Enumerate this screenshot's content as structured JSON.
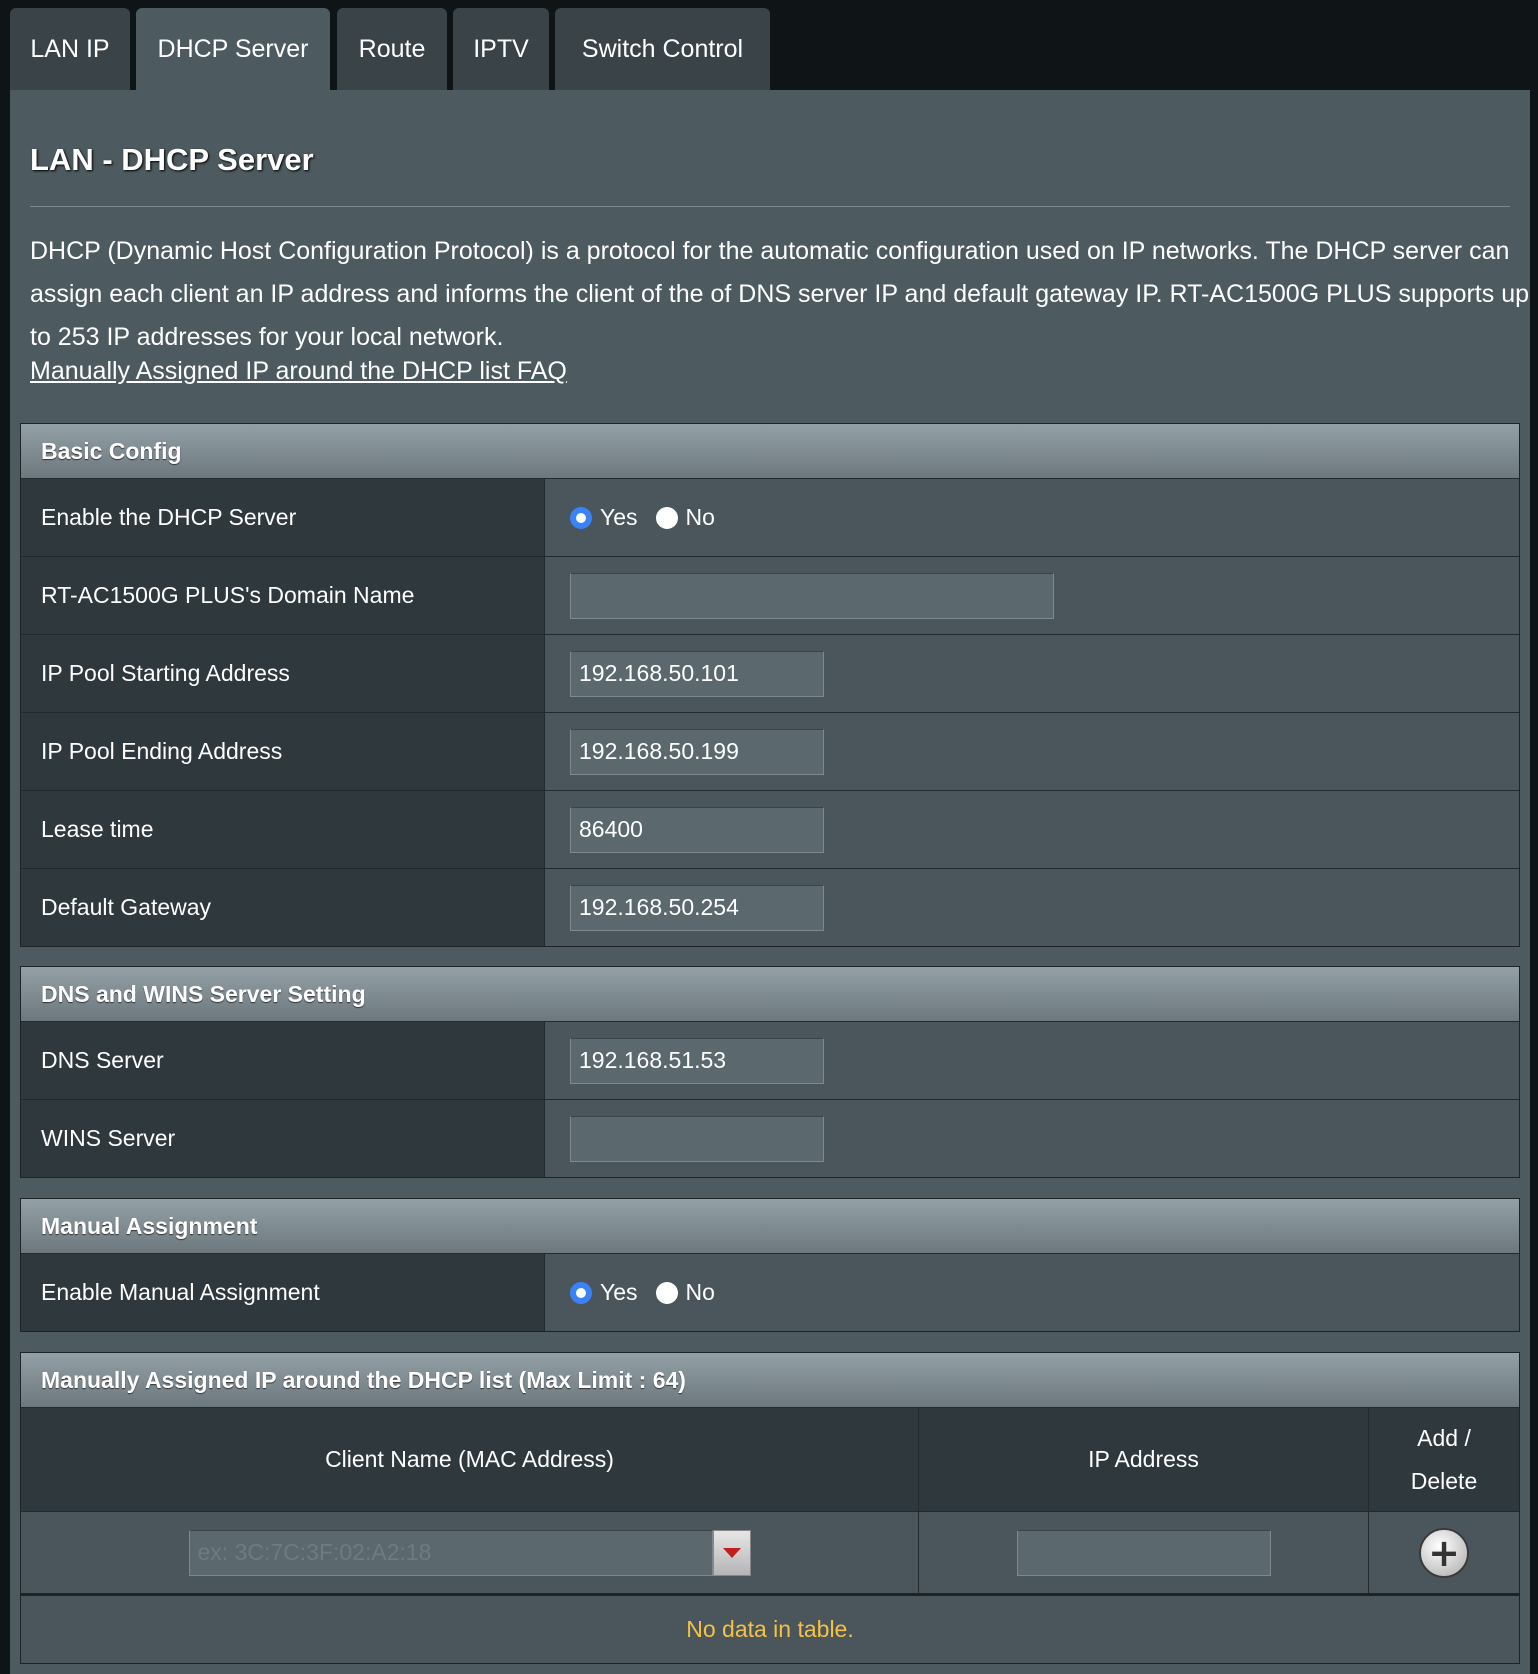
{
  "tabs": [
    {
      "label": "LAN IP"
    },
    {
      "label": "DHCP Server"
    },
    {
      "label": "Route"
    },
    {
      "label": "IPTV"
    },
    {
      "label": "Switch Control"
    }
  ],
  "page": {
    "title": "LAN - DHCP Server",
    "description": "DHCP (Dynamic Host Configuration Protocol) is a protocol for the automatic configuration used on IP networks. The DHCP server can assign each client an IP address and informs the client of the of DNS server IP and default gateway IP. RT-AC1500G PLUS supports up to 253 IP addresses for your local network.",
    "faq_link": "Manually Assigned IP around the DHCP list FAQ"
  },
  "basic": {
    "header": "Basic Config",
    "enable_label": "Enable the DHCP Server",
    "yes": "Yes",
    "no": "No",
    "domain_label": "RT-AC1500G PLUS's Domain Name",
    "domain_value": "",
    "start_label": "IP Pool Starting Address",
    "start_value": "192.168.50.101",
    "end_label": "IP Pool Ending Address",
    "end_value": "192.168.50.199",
    "lease_label": "Lease time",
    "lease_value": "86400",
    "gateway_label": "Default Gateway",
    "gateway_value": "192.168.50.254"
  },
  "dns": {
    "header": "DNS and WINS Server Setting",
    "dns_label": "DNS Server",
    "dns_value": "192.168.51.53",
    "wins_label": "WINS Server",
    "wins_value": ""
  },
  "manual": {
    "header": "Manual Assignment",
    "enable_label": "Enable Manual Assignment",
    "yes": "Yes",
    "no": "No"
  },
  "list": {
    "header": "Manually Assigned IP around the DHCP list (Max Limit : 64)",
    "col_client": "Client Name (MAC Address)",
    "col_ip": "IP Address",
    "col_add_line1": "Add /",
    "col_add_line2": "Delete",
    "mac_placeholder": "ex: 3C:7C:3F:02:A2:18",
    "add_symbol": "+",
    "empty_text": "No data in table."
  },
  "colors": {
    "accent_radio": "#3b82f6",
    "empty_text": "#f5c242",
    "dropdown_arrow": "#c0201b"
  }
}
